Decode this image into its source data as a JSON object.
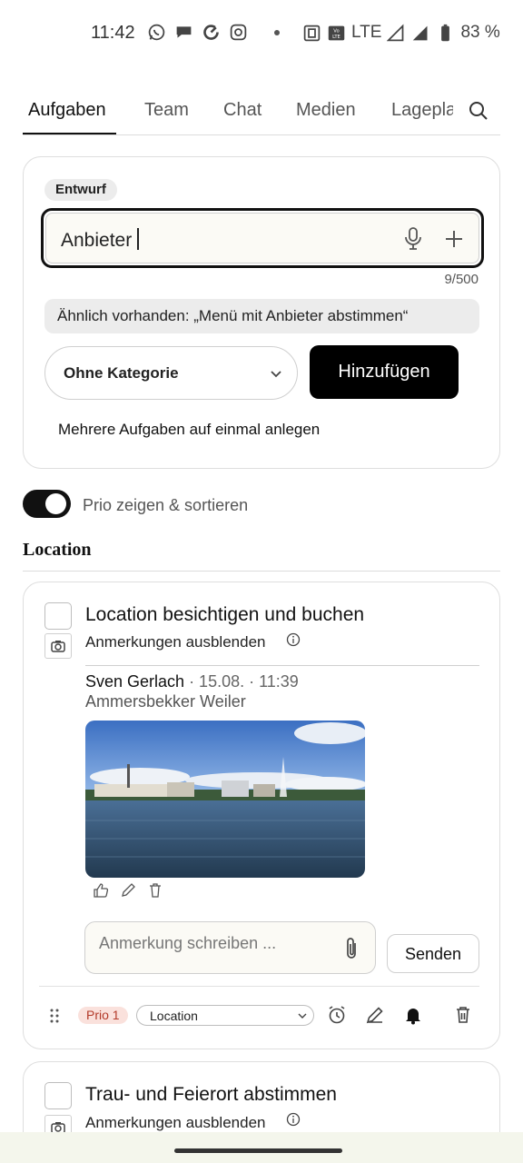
{
  "status_bar": {
    "time": "11:42",
    "network": "LTE",
    "battery": "83 %",
    "icons": [
      "whatsapp-icon",
      "chat-bubble-icon",
      "sync-icon",
      "instagram-icon",
      "dot-icon",
      "nfc-icon",
      "volte-icon",
      "signal-icon",
      "battery-icon"
    ]
  },
  "tabs": {
    "items": [
      {
        "label": "Aufgaben",
        "active": true
      },
      {
        "label": "Team",
        "active": false
      },
      {
        "label": "Chat",
        "active": false
      },
      {
        "label": "Medien",
        "active": false
      },
      {
        "label": "Lagepla",
        "active": false
      }
    ],
    "search_icon": "search-icon"
  },
  "new_task": {
    "badge": "Entwurf",
    "input_value": "Anbieter",
    "counter": "9/500",
    "similar_hint": "Ähnlich vorhanden: „Menü mit Anbieter abstimmen“",
    "category": "Ohne Kategorie",
    "add_label": "Hinzufügen",
    "multi_label": "Mehrere Aufgaben auf einmal anlegen"
  },
  "prio_toggle": {
    "label": "Prio zeigen & sortieren",
    "on": true
  },
  "section": {
    "title": "Location"
  },
  "tasks": [
    {
      "title": "Location besichtigen und buchen",
      "notes_toggle": "Anmerkungen ausblenden",
      "note": {
        "author": "Sven Gerlach",
        "meta": " · 15.08. · 11:39",
        "text": "Ammersbekker Weiler"
      },
      "comment_placeholder": "Anmerkung schreiben ...",
      "send_label": "Senden",
      "prio": "Prio 1",
      "category": "Location"
    },
    {
      "title": "Trau- und Feierort abstimmen",
      "notes_toggle": "Anmerkungen ausblenden"
    }
  ],
  "colors": {
    "accent": "#111111",
    "prio_bg": "#fae1dc",
    "prio_text": "#b33a2a",
    "input_bg": "#fbfaf5",
    "nav_bg": "#f4f6ec"
  }
}
